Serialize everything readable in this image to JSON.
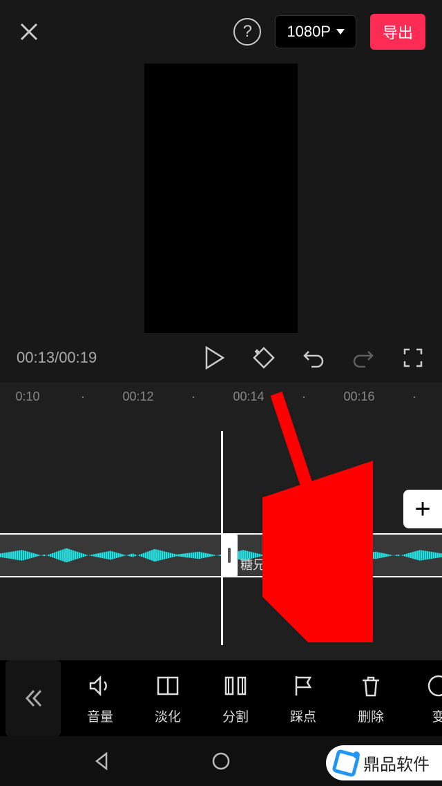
{
  "topbar": {
    "resolution": "1080P",
    "export_label": "导出"
  },
  "transport": {
    "current_time": "00:13",
    "total_time": "00:19"
  },
  "ruler": {
    "ticks": [
      "0:10",
      "·",
      "00:12",
      "·",
      "00:14",
      "·",
      "00:16",
      "·"
    ]
  },
  "timeline": {
    "clip_label": "糖兄创作的原声",
    "add_label": "+"
  },
  "toolbar": {
    "items": [
      {
        "id": "volume",
        "label": "音量"
      },
      {
        "id": "fade",
        "label": "淡化"
      },
      {
        "id": "split",
        "label": "分割"
      },
      {
        "id": "beat",
        "label": "踩点"
      },
      {
        "id": "delete",
        "label": "删除"
      },
      {
        "id": "change",
        "label": "变"
      }
    ]
  },
  "watermark": {
    "text": "鼎品软件"
  }
}
